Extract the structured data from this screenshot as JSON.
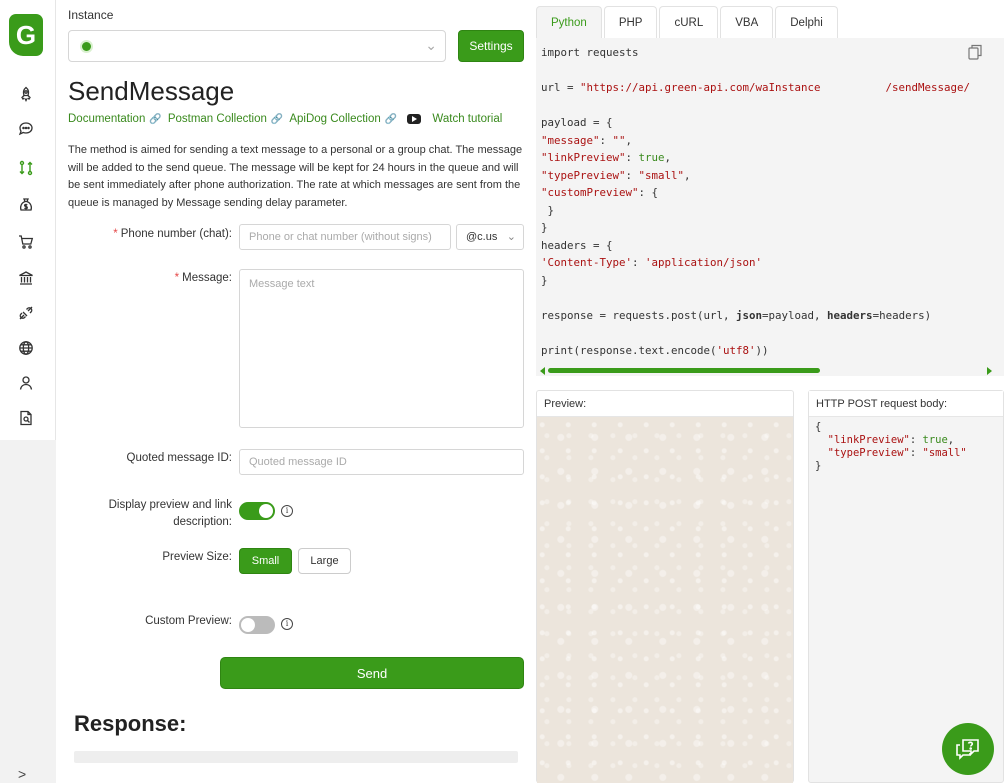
{
  "sidebar": {
    "logo_letter": "G",
    "items": [
      {
        "name": "rocket-icon"
      },
      {
        "name": "chat-icon"
      },
      {
        "name": "api-methods-icon"
      },
      {
        "name": "money-bag-icon"
      },
      {
        "name": "cart-icon"
      },
      {
        "name": "bank-icon"
      },
      {
        "name": "integration-icon"
      },
      {
        "name": "globe-icon"
      },
      {
        "name": "user-icon"
      },
      {
        "name": "document-search-icon"
      }
    ],
    "collapse_glyph": ">"
  },
  "instance": {
    "label": "Instance",
    "status_color": "#3a9b1a",
    "settings_label": "Settings"
  },
  "page": {
    "title": "SendMessage",
    "links": {
      "documentation": "Documentation",
      "postman": "Postman Collection",
      "apidog": "ApiDog Collection",
      "tutorial": "Watch tutorial"
    },
    "description": "The method is aimed for sending a text message to a personal or a group chat. The message will be added to the send queue. The message will be kept for 24 hours in the queue and will be sent immediately after phone authorization. The rate at which messages are sent from the queue is managed by Message sending delay parameter."
  },
  "form": {
    "required_mark": "*",
    "phone_label": "Phone number (chat):",
    "phone_placeholder": "Phone or chat number (without signs)",
    "chat_suffix": "@c.us",
    "message_label": "Message:",
    "message_placeholder": "Message text",
    "quoted_label": "Quoted message ID:",
    "quoted_placeholder": "Quoted message ID",
    "display_preview_label_1": "Display preview and link",
    "display_preview_label_2": "description:",
    "display_preview_on": true,
    "preview_size_label": "Preview Size:",
    "size_small": "Small",
    "size_large": "Large",
    "selected_size": "Small",
    "custom_preview_label": "Custom Preview:",
    "custom_preview_on": false,
    "send_label": "Send",
    "response_title": "Response:"
  },
  "code_panel": {
    "tabs": [
      "Python",
      "PHP",
      "cURL",
      "VBA",
      "Delphi"
    ],
    "active_tab": "Python",
    "preview_title": "Preview:",
    "body_title": "HTTP POST request body:"
  },
  "colors": {
    "accent": "#3a9b1a",
    "string": "#aa1111",
    "required": "#e54848"
  }
}
